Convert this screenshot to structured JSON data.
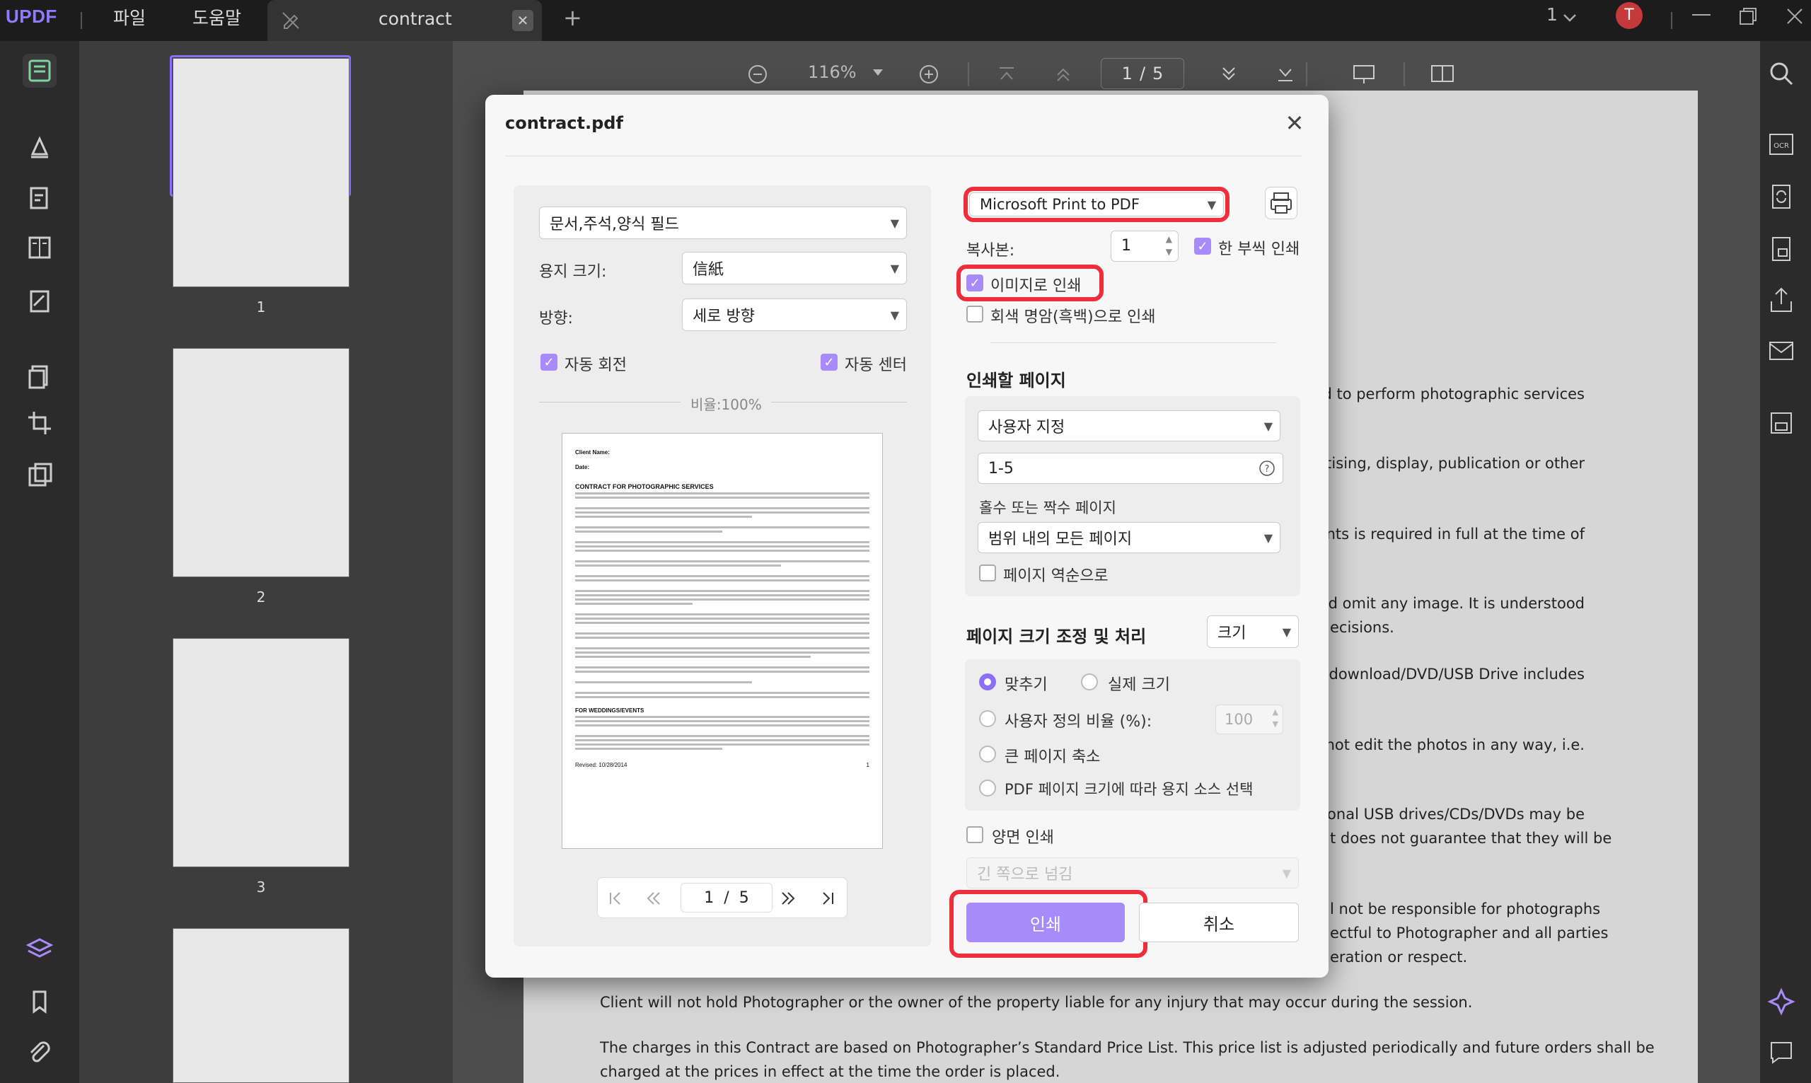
{
  "app": {
    "logo": "UPDF"
  },
  "menu": {
    "file": "파일",
    "help": "도움말"
  },
  "tab": {
    "title": "contract",
    "close": "✕",
    "add": "+"
  },
  "window": {
    "page_indicator": "1",
    "user_initial": "T"
  },
  "toolbar": {
    "zoom": "116%",
    "page_current": "1",
    "page_sep": "/",
    "page_total": "5"
  },
  "thumbnails": [
    {
      "num": "1"
    },
    {
      "num": "2"
    },
    {
      "num": "3"
    }
  ],
  "document": {
    "lines": [
      {
        "text": "ned to perform photographic services"
      },
      {
        "text": "vertising, display, publication or other"
      },
      {
        "text": "prints is required in full at the time of"
      },
      {
        "text": "and omit any image. It is understood"
      },
      {
        "text": "ecisions."
      },
      {
        "text": "il download/DVD/USB Drive includes"
      },
      {
        "text": "will not edit the photos in any way, i.e."
      },
      {
        "text": "tional USB drives/CDs/DVDs may be"
      },
      {
        "text": "t does not guarantee that they will be"
      },
      {
        "text": "l not be responsible for photographs"
      },
      {
        "text": "ectful to Photographer and all parties"
      },
      {
        "text": "eration or respect."
      }
    ],
    "full_line_1": "Client will not hold Photographer or the owner of the property liable for any injury that may occur during the session.",
    "full_line_2": "The charges in this Contract are based on Photographer’s Standard Price List. This price list is adjusted periodically and future orders shall be",
    "full_line_3": "charged at the prices in effect at the time the order is placed."
  },
  "dialog": {
    "title": "contract.pdf",
    "close": "✕",
    "content_select": "문서,주석,양식 필드",
    "paper_size_label": "용지 크기:",
    "paper_size_value": "信紙",
    "orientation_label": "방향:",
    "orientation_value": "세로 방향",
    "auto_rotate": "자동 회전",
    "auto_center": "자동 센터",
    "scale_text": "비율:100%",
    "preview": {
      "client_name": "Client Name:",
      "date": "Date:",
      "heading": "CONTRACT FOR PHOTOGRAPHIC SERVICES",
      "section": "FOR WEDDINGS/EVENTS",
      "footer_left": "Revised: 10/28/2014",
      "footer_right": "1"
    },
    "pager": {
      "current": "1",
      "sep": "/",
      "total": "5"
    },
    "printer": "Microsoft Print to PDF",
    "copies_label": "복사본:",
    "copies_value": "1",
    "collate": "한 부씩 인쇄",
    "print_as_image": "이미지로 인쇄",
    "grayscale": "회색 명암(흑백)으로 인쇄",
    "pages_heading": "인쇄할 페이지",
    "pages_mode": "사용자 지정",
    "pages_range": "1-5",
    "odd_even_label": "홀수 또는 짝수 페이지",
    "odd_even_value": "범위 내의 모든 페이지",
    "reverse": "페이지 역순으로",
    "sizing_heading": "페이지 크기 조정 및 처리",
    "sizing_mode": "크기",
    "fit": "맞추기",
    "actual_size": "실제 크기",
    "custom_scale": "사용자 정의 비율 (%):",
    "custom_scale_value": "100",
    "shrink_large": "큰 페이지 축소",
    "pdf_paper_source": "PDF 페이지 크기에 따라 용지 소스 선택",
    "duplex": "양면 인쇄",
    "duplex_flip": "긴 쪽으로 넘김",
    "print_button": "인쇄",
    "cancel_button": "취소"
  },
  "colors": {
    "accent": "#a78bfa",
    "highlight": "#ee2e3a"
  }
}
